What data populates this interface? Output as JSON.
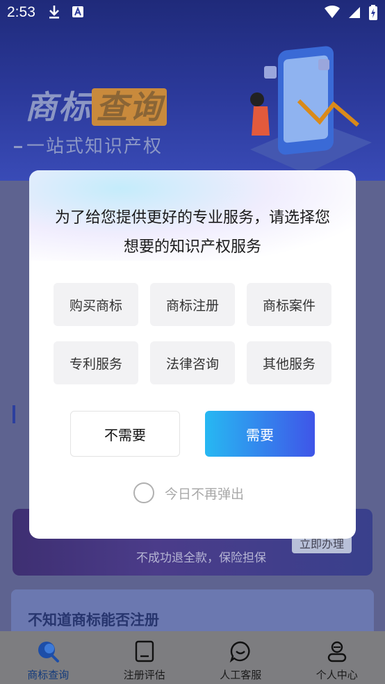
{
  "status_bar": {
    "time": "2:53",
    "icons": [
      "download-icon",
      "font-a-icon",
      "wifi-icon",
      "signal-icon",
      "battery-icon"
    ]
  },
  "banner": {
    "title_part1": "商标",
    "title_part2": "查询",
    "subtitle": "一站式知识产权"
  },
  "promo": {
    "subtitle": "不成功退全款，保险担保",
    "button_label": "立即办理"
  },
  "info_card": {
    "title": "不知道商标能否注册"
  },
  "tabbar": {
    "tabs": [
      {
        "label": "商标查询",
        "icon": "trademark-search-icon",
        "active": true
      },
      {
        "label": "注册评估",
        "icon": "document-icon",
        "active": false
      },
      {
        "label": "人工客服",
        "icon": "chat-bubble-icon",
        "active": false
      },
      {
        "label": "个人中心",
        "icon": "person-icon",
        "active": false
      }
    ]
  },
  "dialog": {
    "message": "为了给您提供更好的专业服务，请选择您想要的知识产权服务",
    "options": [
      "购买商标",
      "商标注册",
      "商标案件",
      "专利服务",
      "法律咨询",
      "其他服务"
    ],
    "decline_label": "不需要",
    "accept_label": "需要",
    "dont_show_label": "今日不再弹出",
    "dont_show_checked": false
  },
  "colors": {
    "accept_gradient_start": "#27b8f2",
    "accept_gradient_end": "#3f55e8",
    "option_bg": "#f2f2f4",
    "tab_active": "#123a7c"
  }
}
